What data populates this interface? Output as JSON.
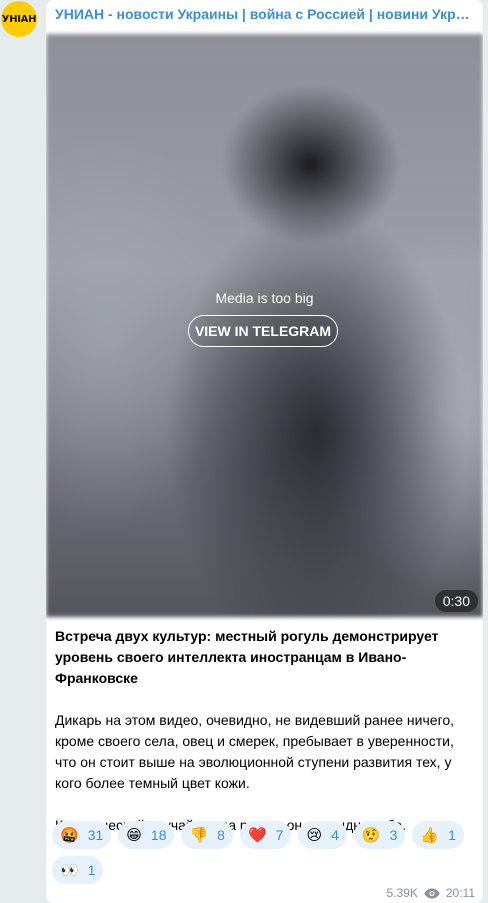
{
  "channel": {
    "avatar_text": "УНІАН",
    "title": "УНИАН - новости Украины | война с Россией | новини України | війна з Росією"
  },
  "media": {
    "message": "Media is too big",
    "button_label": "VIEW IN TELEGRAM",
    "duration": "0:30"
  },
  "post": {
    "headline": "Встреча двух культур: местный рогуль демонстрирует уровень своего интеллекта иностранцам в Ивано-Франковске",
    "paragraph1": "Дикарь на этом видео, очевидно, не видевший ранее ничего, кроме своего села, овец и смерек, пребывает в уверенности, что он стоит выше на эволюционной ступени развития тех, у кого более темный цвет кожи.",
    "paragraph2": "Классический случай, когда рогуль он, а стыдно тебе."
  },
  "reactions": [
    {
      "emoji": "🤬",
      "icon": "angry-face-icon",
      "count": "31"
    },
    {
      "emoji": "😁",
      "icon": "grinning-face-icon",
      "count": "18"
    },
    {
      "emoji": "👎",
      "icon": "thumbs-down-icon",
      "count": "8"
    },
    {
      "emoji": "❤️",
      "icon": "heart-icon",
      "count": "7"
    },
    {
      "emoji": "😢",
      "icon": "crying-face-icon",
      "count": "4"
    },
    {
      "emoji": "🤨",
      "icon": "raised-eyebrow-face-icon",
      "count": "3"
    },
    {
      "emoji": "👍",
      "icon": "thumbs-up-icon",
      "count": "1"
    },
    {
      "emoji": "👀",
      "icon": "eyes-icon",
      "count": "1"
    }
  ],
  "meta": {
    "views": "5.39K",
    "time": "20:11"
  },
  "colors": {
    "accent": "#3a8fd2",
    "reaction_bg": "#e7f1fb",
    "avatar_bg": "#ffcc00"
  }
}
